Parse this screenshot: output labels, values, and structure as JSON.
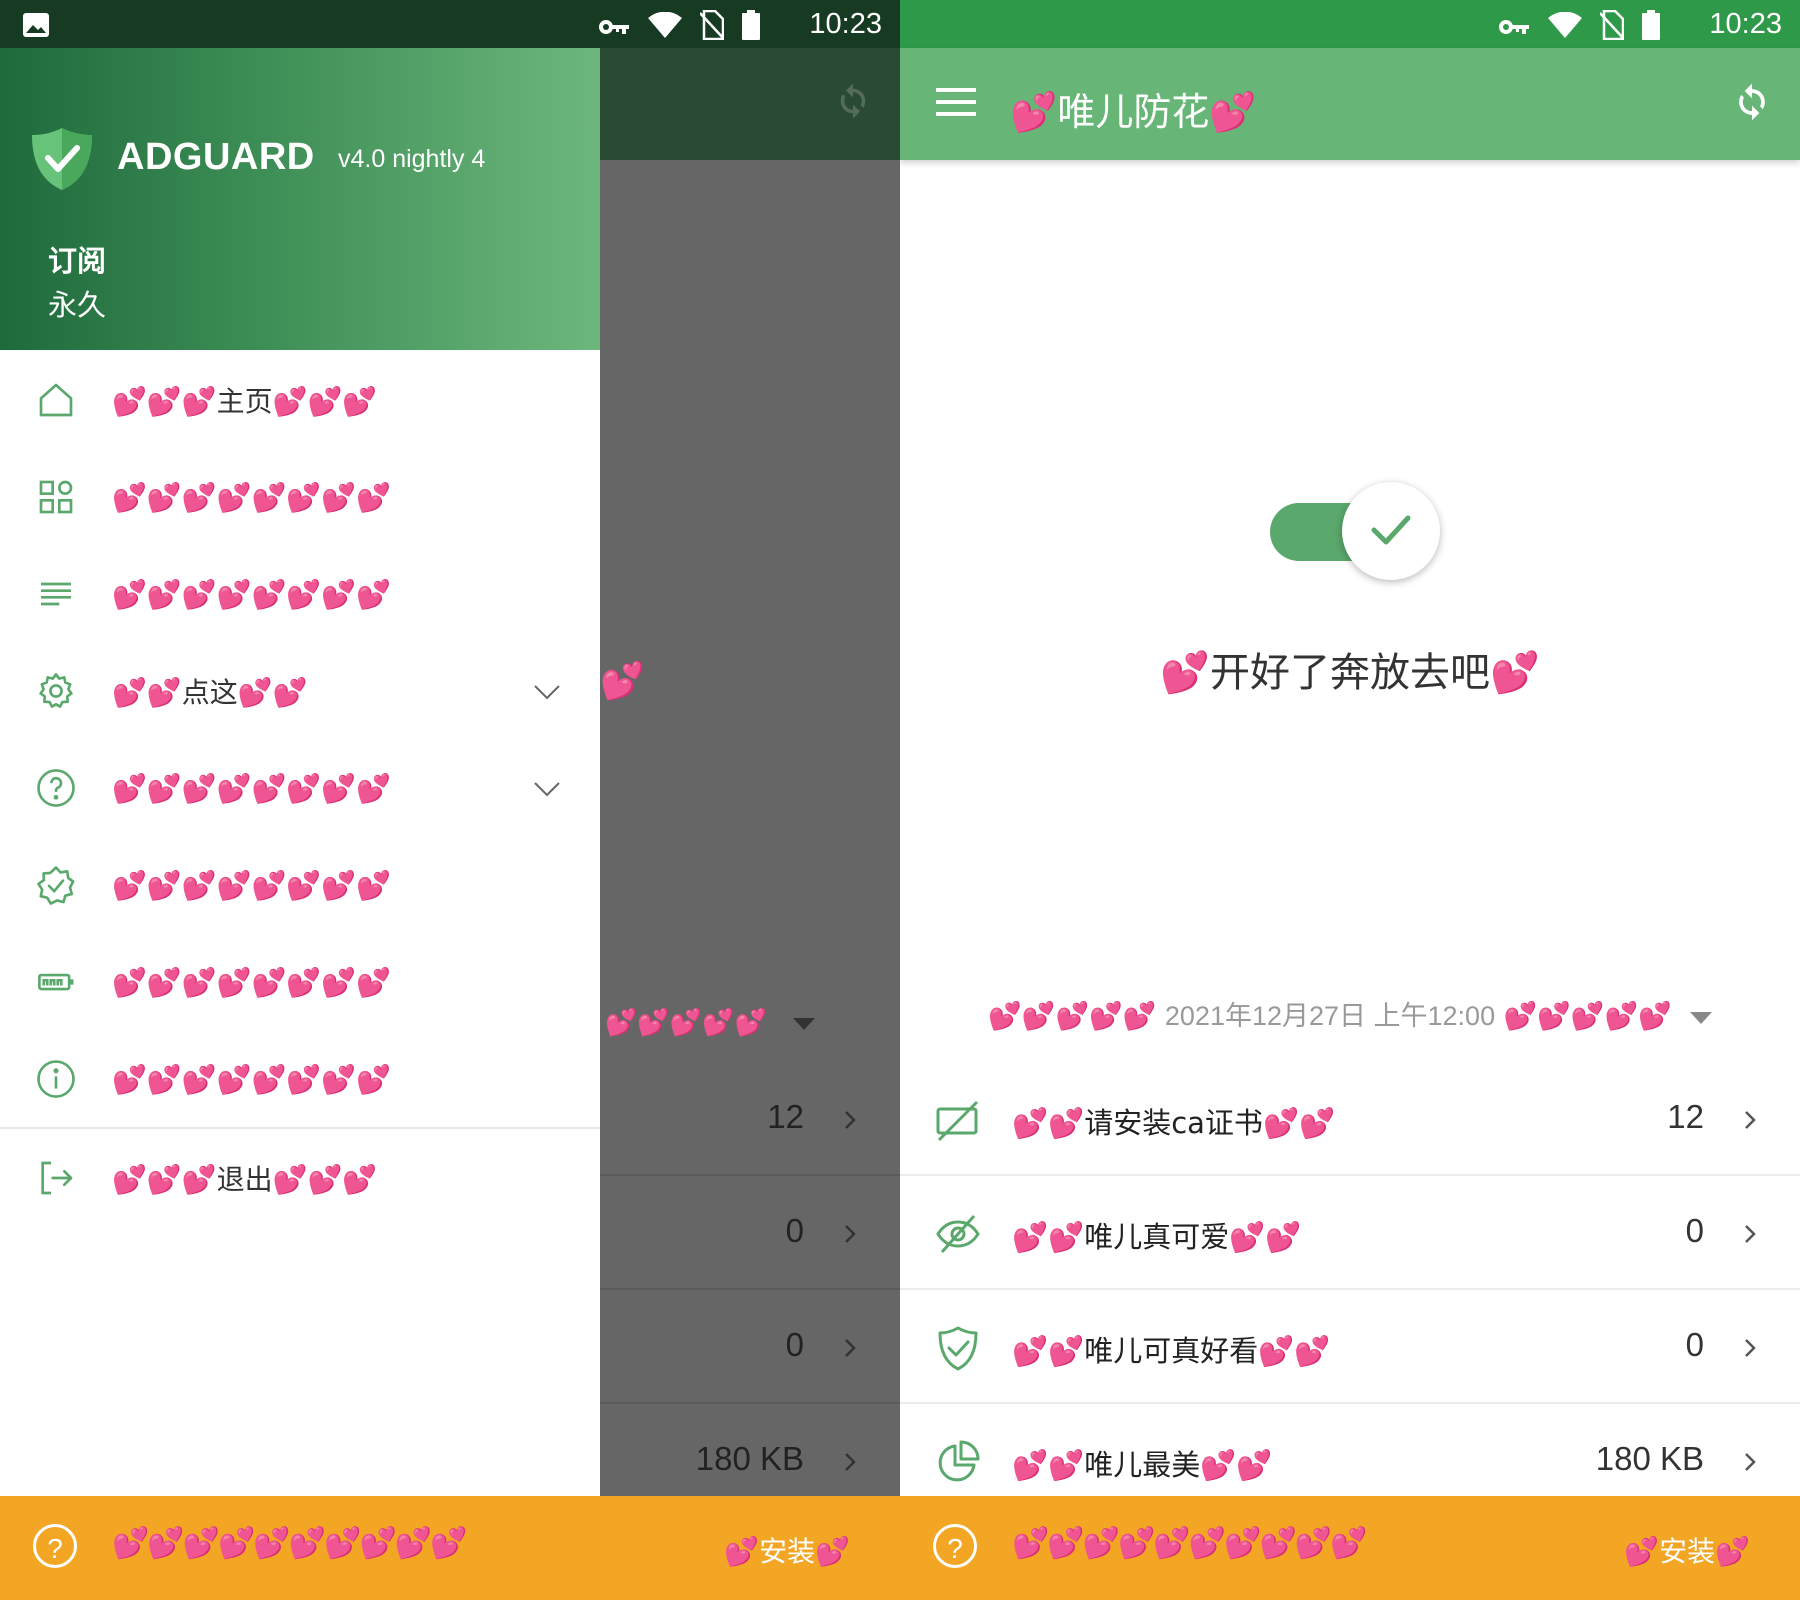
{
  "status_bar": {
    "time": "10:23"
  },
  "drawer": {
    "brand": "ADGUARD",
    "version": "v4.0 nightly 4",
    "subscription_label": "订阅",
    "subscription_value": "永久",
    "items": [
      {
        "label_pre": "💕💕💕",
        "label_text": "主页",
        "label_post": "💕💕💕",
        "icon": "home-icon"
      },
      {
        "label_pre": "💕💕💕💕💕💕💕💕",
        "label_text": "",
        "label_post": "",
        "icon": "apps-grid-icon"
      },
      {
        "label_pre": "💕💕💕💕💕💕💕💕",
        "label_text": "",
        "label_post": "",
        "icon": "list-icon"
      },
      {
        "label_pre": "💕💕",
        "label_text": "点这",
        "label_post": "💕💕",
        "icon": "gear-icon"
      },
      {
        "label_pre": "💕💕💕💕💕💕💕💕",
        "label_text": "",
        "label_post": "",
        "icon": "help-circle-icon"
      },
      {
        "label_pre": "💕💕💕💕💕💕💕💕",
        "label_text": "",
        "label_post": "",
        "icon": "badge-icon"
      },
      {
        "label_pre": "💕💕💕💕💕💕💕💕",
        "label_text": "",
        "label_post": "",
        "icon": "battery-icon"
      },
      {
        "label_pre": "💕💕💕💕💕💕💕💕",
        "label_text": "",
        "label_post": "",
        "icon": "info-icon"
      }
    ],
    "logout": {
      "label_pre": "💕💕💕",
      "label_text": "退出",
      "label_post": "💕💕💕"
    }
  },
  "left_underlay": {
    "stats": [
      "12",
      "0",
      "0",
      "180 KB"
    ]
  },
  "main": {
    "title_pre": "💕",
    "title_text": "唯儿防花",
    "title_post": "💕",
    "protection_on": true,
    "status_pre": "💕",
    "status_text": "开好了奔放去吧",
    "status_post": "💕",
    "date_pre": "💕💕💕💕💕",
    "date_text": "2021年12月27日 上午12:00",
    "date_post": "💕💕💕💕💕",
    "stats": [
      {
        "pre": "💕💕",
        "text": "请安装ca证书",
        "post": "💕💕",
        "value": "12",
        "icon": "no-cert-icon"
      },
      {
        "pre": "💕💕",
        "text": "唯儿真可爱",
        "post": "💕💕",
        "value": "0",
        "icon": "eye-off-icon"
      },
      {
        "pre": "💕💕",
        "text": "唯儿可真好看",
        "post": "💕💕",
        "value": "0",
        "icon": "shield-check-icon"
      },
      {
        "pre": "💕💕",
        "text": "唯儿最美",
        "post": "💕💕",
        "value": "180 KB",
        "icon": "pie-chart-icon"
      }
    ]
  },
  "bottom_bar": {
    "hearts": "💕💕💕💕💕💕💕💕💕💕",
    "install_pre": "💕",
    "install_text": "安装",
    "install_post": "💕"
  },
  "colors": {
    "status_bar_green": "#2e9a49",
    "toolbar_green": "#67b677",
    "orange": "#f2a623",
    "heart_pink": "#d6497f",
    "icon_green": "#5aa86c"
  }
}
